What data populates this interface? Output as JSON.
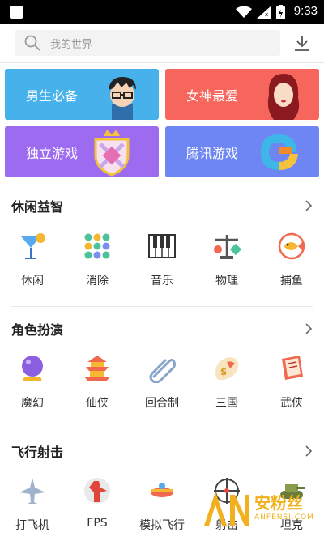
{
  "status_bar": {
    "time": "9:33"
  },
  "search": {
    "placeholder": "我的世界"
  },
  "banners": [
    {
      "label": "男生必备",
      "color": "#46b1ea"
    },
    {
      "label": "女神最爱",
      "color": "#f6665c"
    },
    {
      "label": "独立游戏",
      "color": "#9c6bef"
    },
    {
      "label": "腾讯游戏",
      "color": "#6e85f4"
    }
  ],
  "sections": [
    {
      "title": "休闲益智",
      "items": [
        {
          "label": "休闲",
          "icon": "cocktail-icon"
        },
        {
          "label": "消除",
          "icon": "dots-grid-icon"
        },
        {
          "label": "音乐",
          "icon": "piano-icon"
        },
        {
          "label": "物理",
          "icon": "balance-scale-icon"
        },
        {
          "label": "捕鱼",
          "icon": "fish-icon"
        }
      ]
    },
    {
      "title": "角色扮演",
      "items": [
        {
          "label": "魔幻",
          "icon": "crystal-ball-icon"
        },
        {
          "label": "仙侠",
          "icon": "pagoda-icon"
        },
        {
          "label": "回合制",
          "icon": "paperclip-icon"
        },
        {
          "label": "三国",
          "icon": "scroll-icon"
        },
        {
          "label": "武侠",
          "icon": "book-icon"
        }
      ]
    },
    {
      "title": "飞行射击",
      "items": [
        {
          "label": "打飞机",
          "icon": "jet-icon"
        },
        {
          "label": "FPS",
          "icon": "shooter-icon"
        },
        {
          "label": "模拟飞行",
          "icon": "plane-icon"
        },
        {
          "label": "射击",
          "icon": "crosshair-icon"
        },
        {
          "label": "坦克",
          "icon": "tank-icon"
        }
      ]
    }
  ],
  "watermark": {
    "text_cn": "安粉丝",
    "text_en": "ANFENSI.COM",
    "logo_letters": "AN"
  }
}
